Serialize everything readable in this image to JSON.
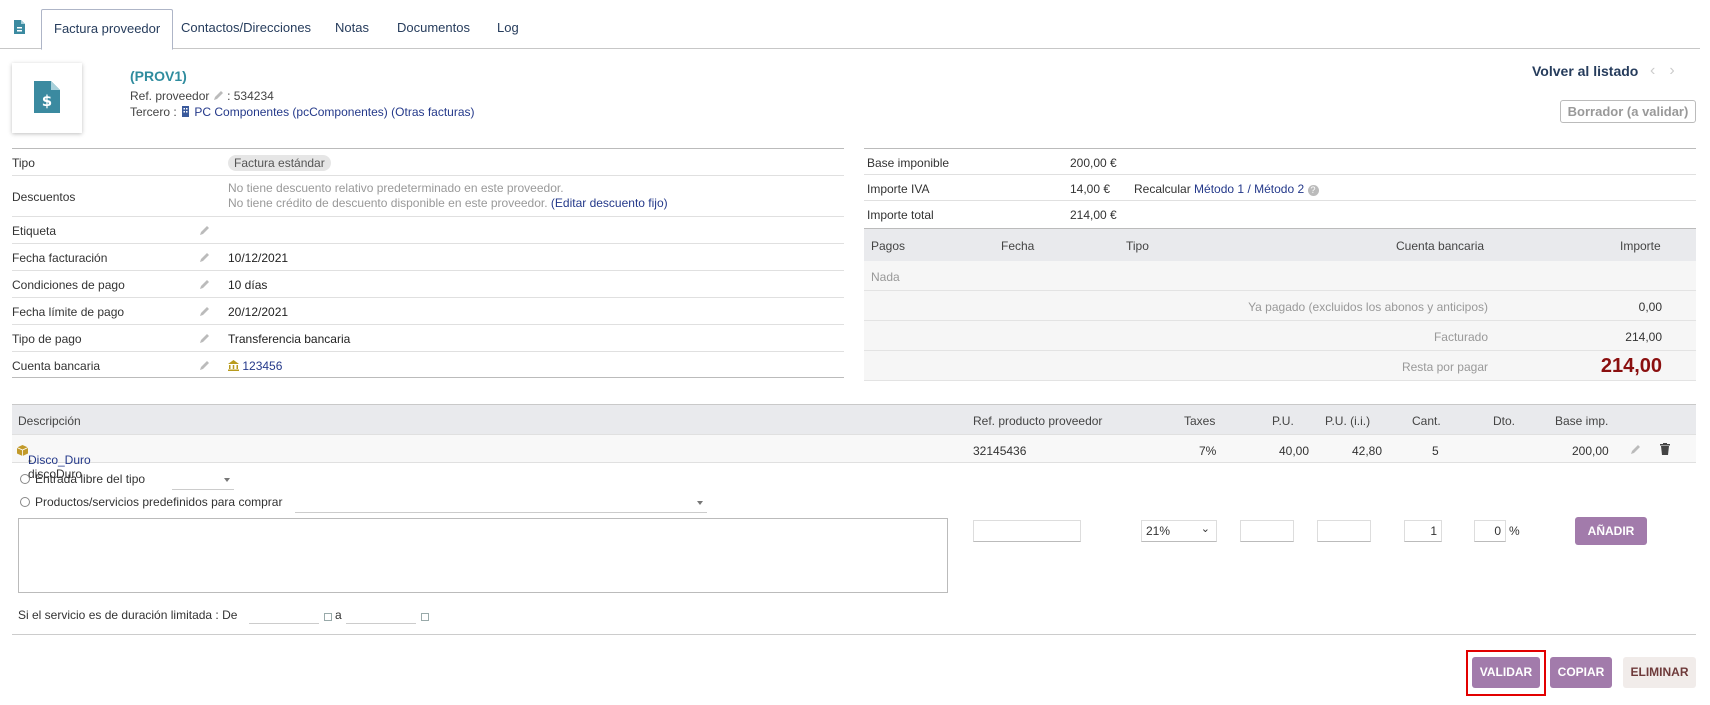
{
  "tabs": {
    "items": [
      "Factura proveedor",
      "Contactos/Direcciones",
      "Notas",
      "Documentos",
      "Log"
    ]
  },
  "header": {
    "ref": "(PROV1)",
    "ref_proveedor_label": "Ref. proveedor",
    "ref_proveedor_value": ": 534234",
    "tercero_label": "Tercero :",
    "tercero_name": "PC Componentes (pcComponentes)",
    "otras_facturas": "(Otras facturas)",
    "back_label": "Volver al listado",
    "status": "Borrador (a validar)"
  },
  "fields": {
    "tipo_label": "Tipo",
    "tipo_value": "Factura estándar",
    "descuentos_label": "Descuentos",
    "descuentos_line1": "No tiene descuento relativo predeterminado en este proveedor.",
    "descuentos_line2": "No tiene crédito de descuento disponible en este proveedor.",
    "descuentos_link": "(Editar descuento fijo)",
    "etiqueta_label": "Etiqueta",
    "fecha_facturacion_label": "Fecha facturación",
    "fecha_facturacion_value": "10/12/2021",
    "condiciones_label": "Condiciones de pago",
    "condiciones_value": "10 días",
    "fecha_limite_label": "Fecha límite de pago",
    "fecha_limite_value": "20/12/2021",
    "tipo_pago_label": "Tipo de pago",
    "tipo_pago_value": "Transferencia bancaria",
    "cuenta_label": "Cuenta bancaria",
    "cuenta_value": "123456"
  },
  "amounts": {
    "base_label": "Base imponible",
    "base_value": "200,00 €",
    "iva_label": "Importe IVA",
    "iva_value": "14,00 €",
    "recalcular": "Recalcular",
    "metodo1": "Método 1",
    "sep": "/",
    "metodo2": "Método 2",
    "total_label": "Importe total",
    "total_value": "214,00 €"
  },
  "payments": {
    "headers": [
      "Pagos",
      "Fecha",
      "Tipo",
      "Cuenta bancaria",
      "Importe"
    ],
    "none": "Nada",
    "ya_pagado_label": "Ya pagado (excluidos los abonos y anticipos)",
    "ya_pagado_value": "0,00",
    "facturado_label": "Facturado",
    "facturado_value": "214,00",
    "resta_label": "Resta por pagar",
    "resta_value": "214,00"
  },
  "lines": {
    "headers": [
      "Descripción",
      "Ref. producto proveedor",
      "Taxes",
      "P.U.",
      "P.U. (i.i.)",
      "Cant.",
      "Dto.",
      "Base imp."
    ],
    "rows": [
      {
        "product": "Disco_Duro",
        "desc": " - discoDuro",
        "ref": "32145436",
        "tax": "7%",
        "pu": "40,00",
        "pu_ii": "42,80",
        "qty": "5",
        "base": "200,00"
      }
    ]
  },
  "newline": {
    "libre_label": "Entrada libre del tipo",
    "predef_label": "Productos/servicios predefinidos para comprar",
    "tax_value": "21%",
    "qty_value": "1",
    "dto_value": "0",
    "percent": "%",
    "add_button": "Añadir",
    "duracion_label": "Si el servicio es de duración limitada : De",
    "a_label": "a"
  },
  "actions": {
    "validar": "Validar",
    "copiar": "Copiar",
    "eliminar": "Eliminar"
  },
  "colors": {
    "accent": "#a27bab",
    "remaining": "#8a0f0f",
    "highlight": "#e20000"
  }
}
